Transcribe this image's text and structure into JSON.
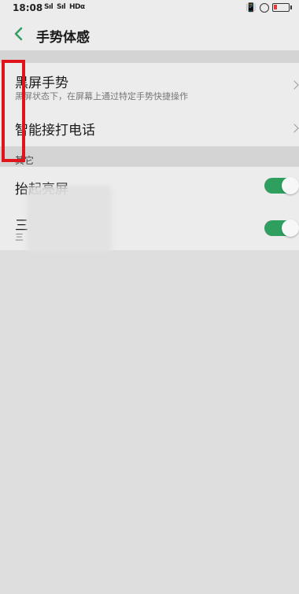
{
  "status_bar": {
    "time": "18:08",
    "signal_1": "Sıl",
    "signal_2": "Sıl",
    "network": "HDα"
  },
  "header": {
    "title": "手势体感"
  },
  "gesture_section": {
    "items": [
      {
        "label": "黑屏手势",
        "subtitle": "黑屏状态下，在屏幕上通过特定手势快捷操作"
      },
      {
        "label": "智能接打电话"
      }
    ]
  },
  "other_section": {
    "title": "其它",
    "items": [
      {
        "label": "抬起亮屏",
        "enabled": true
      },
      {
        "label": "三",
        "subtitle": "三",
        "enabled": true
      }
    ]
  },
  "colors": {
    "accent": "#2f9f5f",
    "highlight": "#e0141b",
    "background": "#dedede"
  }
}
